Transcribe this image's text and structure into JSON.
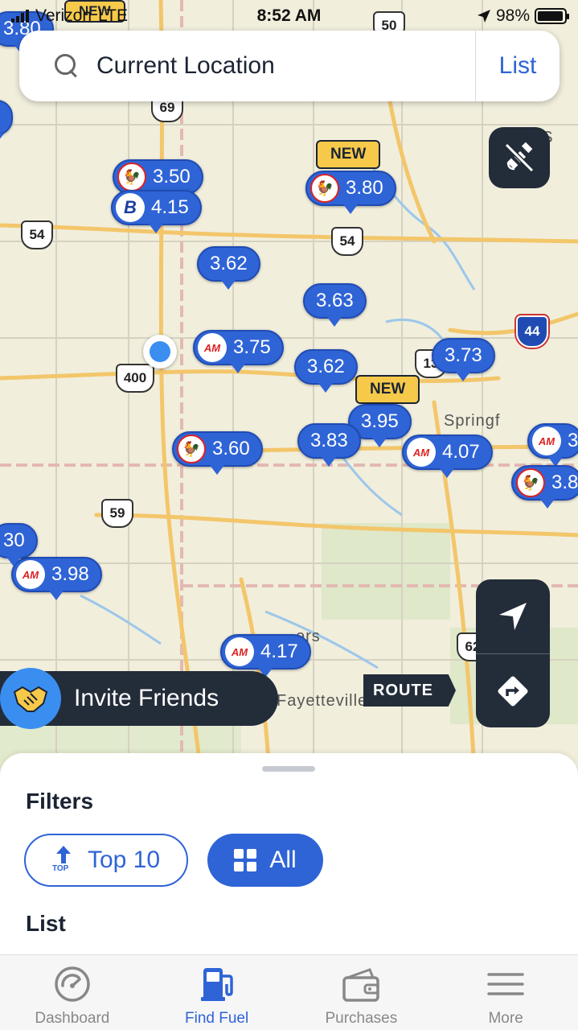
{
  "status_bar": {
    "carrier": "Verizon",
    "network": "LTE",
    "time": "8:52 AM",
    "battery": "98%",
    "battery_level": 0.98
  },
  "search": {
    "query": "Current Location",
    "list_label": "List"
  },
  "map": {
    "new_label": "NEW",
    "pins": [
      {
        "price": "3.80",
        "brand": ""
      },
      {
        "price": "3.50",
        "brand": "rooster"
      },
      {
        "price": "4.15",
        "brand": "b"
      },
      {
        "price": "3.80",
        "brand": "rooster"
      },
      {
        "price": "3.62",
        "brand": ""
      },
      {
        "price": "3.63",
        "brand": ""
      },
      {
        "price": "3.75",
        "brand": "AM"
      },
      {
        "price": "3.62",
        "brand": ""
      },
      {
        "price": "3.73",
        "brand": ""
      },
      {
        "price": "3.95",
        "brand": ""
      },
      {
        "price": "3.83",
        "brand": ""
      },
      {
        "price": "4.07",
        "brand": "AM"
      },
      {
        "price": "3.60",
        "brand": "rooster"
      },
      {
        "price": "3.98",
        "brand": "AM"
      },
      {
        "price": "4.17",
        "brand": "AM"
      },
      {
        "price": "3",
        "brand": "AM"
      },
      {
        "price": "3.8",
        "brand": "rooster"
      },
      {
        "price": "30",
        "brand": ""
      }
    ],
    "brand_am": "AM",
    "brand_rooster": "🐓",
    "brand_b": "B",
    "shields": {
      "us54a": "54",
      "us54b": "54",
      "hwy69": "69",
      "hwy400": "400",
      "us59": "59",
      "us62": "62",
      "us50": "50",
      "hwy13": "13",
      "i44": "44"
    },
    "places": {
      "springfield": "Springf",
      "fayetteville": "Fayetteville",
      "rogers": "ers",
      "missouri": "MIS"
    }
  },
  "controls": {
    "route_label": "ROUTE",
    "invite_label": "Invite Friends"
  },
  "sheet": {
    "filters_title": "Filters",
    "top10_label": "Top 10",
    "top_badge": "TOP",
    "all_label": "All",
    "list_title": "List"
  },
  "tabs": [
    {
      "label": "Dashboard"
    },
    {
      "label": "Find Fuel"
    },
    {
      "label": "Purchases"
    },
    {
      "label": "More"
    }
  ],
  "colors": {
    "accent": "#2f64d6",
    "dark_control": "#232c39",
    "new_tag": "#f6c94a"
  }
}
